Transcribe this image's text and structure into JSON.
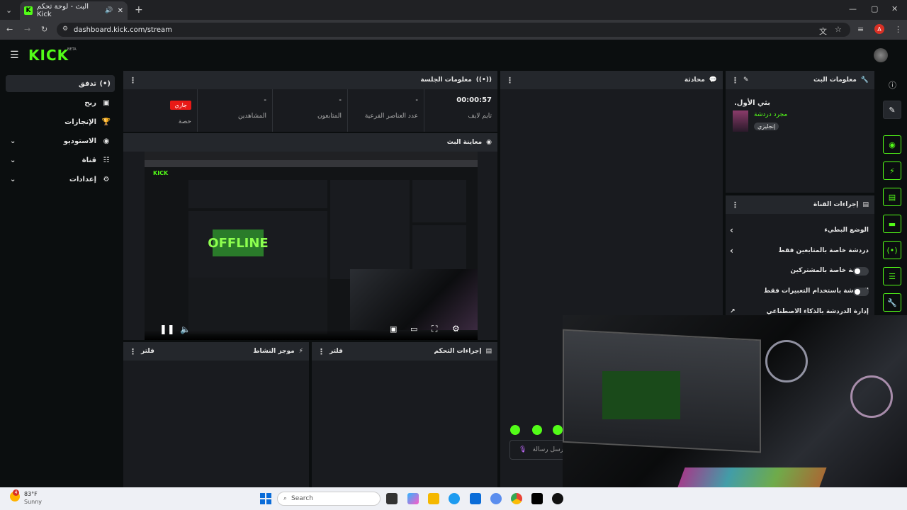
{
  "browser": {
    "tab_title": "البث - لوحة تحكم Kick",
    "url": "dashboard.kick.com/stream",
    "profile_initial": "A"
  },
  "header": {
    "logo": "KICK",
    "beta": "BETA"
  },
  "sidebar": {
    "items": [
      {
        "label": "تدفق",
        "icon": "broadcast-icon",
        "active": true
      },
      {
        "label": "ربح",
        "icon": "money-icon"
      },
      {
        "label": "الإنجازات",
        "icon": "trophy-icon"
      },
      {
        "label": "الاستوديو",
        "icon": "studio-icon",
        "expandable": true
      },
      {
        "label": "قناة",
        "icon": "channel-icon",
        "expandable": true
      },
      {
        "label": "إعدادات",
        "icon": "gear-icon",
        "expandable": true
      }
    ]
  },
  "session": {
    "title": "معلومات الجلسة",
    "live_badge": "جاري",
    "stats": [
      {
        "value": "جاري",
        "label": "حصة"
      },
      {
        "value": "-",
        "label": "المشاهدين"
      },
      {
        "value": "-",
        "label": "المتابعون"
      },
      {
        "value": "-",
        "label": "عدد العناصر الفرعية"
      },
      {
        "value": "00:00:57",
        "label": "تايم لايف"
      }
    ]
  },
  "preview": {
    "title": "معاينة البث",
    "offline_text": "OFFLINE"
  },
  "chat": {
    "title": "محادثة",
    "input_placeholder": "أرسل رسالة"
  },
  "stream_info": {
    "title": "معلومات البث",
    "stream_title": "بثي الأول.",
    "category": "مجرد دردشة",
    "language": "إنجليزي"
  },
  "channel_actions": {
    "title": "إجراءات القناة",
    "items": [
      {
        "label": "الوضع البطيء",
        "control": "chevron"
      },
      {
        "label": "دردشة خاصة بالمتابعين فقط",
        "control": "chevron"
      },
      {
        "label": "دردشة خاصة بالمشتركين",
        "control": "toggle"
      },
      {
        "label": "الدردشة باستخدام التعبيرات فقط",
        "control": "toggle"
      },
      {
        "label": "إدارة الدردشة بالذكاء الاصطناعي",
        "control": "link"
      }
    ]
  },
  "activity": {
    "title": "موجز النشاط",
    "filter": "فلتر"
  },
  "mod_actions": {
    "title": "إجراءات التحكم",
    "filter": "فلتر"
  },
  "taskbar": {
    "weather_temp": "83°F",
    "weather_desc": "Sunny",
    "weather_badge": "4",
    "search_placeholder": "Search"
  },
  "colors": {
    "accent": "#53fc18",
    "live": "#e91916",
    "panel": "#191b1f",
    "panel_header": "#24272c"
  }
}
